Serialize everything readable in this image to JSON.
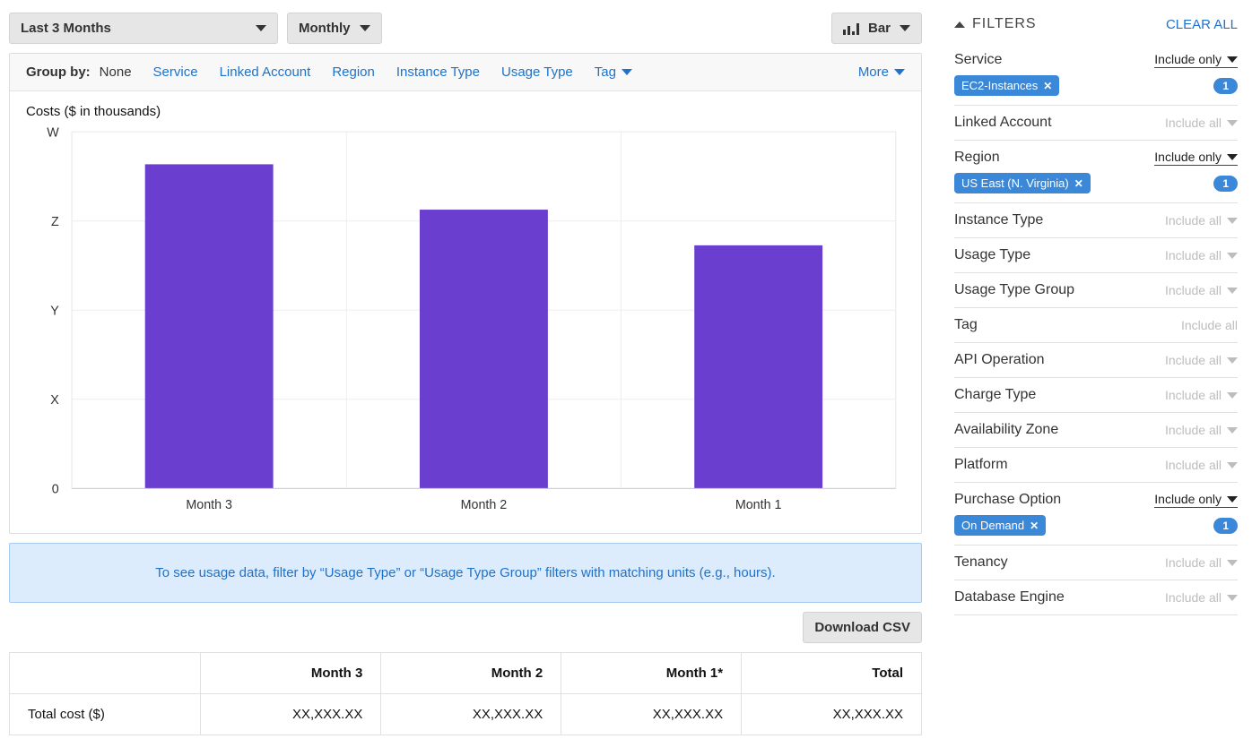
{
  "toolbar": {
    "date_range_label": "Last 3 Months",
    "granularity_label": "Monthly",
    "chart_type_label": "Bar"
  },
  "groupby": {
    "label": "Group by:",
    "current": "None",
    "options": [
      "Service",
      "Linked Account",
      "Region",
      "Instance Type",
      "Usage Type",
      "Tag"
    ],
    "more_label": "More"
  },
  "chart_title": "Costs ($ in thousands)",
  "chart_data": {
    "type": "bar",
    "categories": [
      "Month 3",
      "Month 2",
      "Month 1"
    ],
    "values": [
      100,
      86,
      75
    ],
    "ylabel": "",
    "xlabel": "",
    "y_tick_labels": [
      "0",
      "X",
      "Y",
      "Z",
      "W"
    ],
    "ylim": [
      0,
      110
    ],
    "color": "#6a3fcf",
    "note": "Y-axis ticks are obfuscated letters in the source image (0, X, Y, Z, W). Bar heights are estimated relative to the W tick."
  },
  "info_banner": "To see usage data, filter by “Usage Type” or “Usage Type Group” filters with matching units (e.g., hours).",
  "download_csv_label": "Download CSV",
  "table": {
    "row_label": "Total cost ($)",
    "headers": [
      "",
      "Month 3",
      "Month 2",
      "Month 1*",
      "Total"
    ],
    "row_values": [
      "Total cost ($)",
      "XX,XXX.XX",
      "XX,XXX.XX",
      "XX,XXX.XX",
      "XX,XXX.XX"
    ]
  },
  "filters_title": "FILTERS",
  "clear_all_label": "CLEAR ALL",
  "filters": [
    {
      "name": "Service",
      "mode": "Include only",
      "active": true,
      "chips": [
        "EC2-Instances"
      ],
      "count": "1",
      "has_arrow": true
    },
    {
      "name": "Linked Account",
      "mode": "Include all",
      "active": false,
      "chips": [],
      "count": "",
      "has_arrow": true
    },
    {
      "name": "Region",
      "mode": "Include only",
      "active": true,
      "chips": [
        "US East (N. Virginia)"
      ],
      "count": "1",
      "has_arrow": true
    },
    {
      "name": "Instance Type",
      "mode": "Include all",
      "active": false,
      "chips": [],
      "count": "",
      "has_arrow": true
    },
    {
      "name": "Usage Type",
      "mode": "Include all",
      "active": false,
      "chips": [],
      "count": "",
      "has_arrow": true
    },
    {
      "name": "Usage Type Group",
      "mode": "Include all",
      "active": false,
      "chips": [],
      "count": "",
      "has_arrow": true
    },
    {
      "name": "Tag",
      "mode": "Include all",
      "active": false,
      "chips": [],
      "count": "",
      "has_arrow": false
    },
    {
      "name": "API Operation",
      "mode": "Include all",
      "active": false,
      "chips": [],
      "count": "",
      "has_arrow": true
    },
    {
      "name": "Charge Type",
      "mode": "Include all",
      "active": false,
      "chips": [],
      "count": "",
      "has_arrow": true
    },
    {
      "name": "Availability Zone",
      "mode": "Include all",
      "active": false,
      "chips": [],
      "count": "",
      "has_arrow": true
    },
    {
      "name": "Platform",
      "mode": "Include all",
      "active": false,
      "chips": [],
      "count": "",
      "has_arrow": true
    },
    {
      "name": "Purchase Option",
      "mode": "Include only",
      "active": true,
      "chips": [
        "On Demand"
      ],
      "count": "1",
      "has_arrow": true
    },
    {
      "name": "Tenancy",
      "mode": "Include all",
      "active": false,
      "chips": [],
      "count": "",
      "has_arrow": true
    },
    {
      "name": "Database Engine",
      "mode": "Include all",
      "active": false,
      "chips": [],
      "count": "",
      "has_arrow": true
    }
  ]
}
